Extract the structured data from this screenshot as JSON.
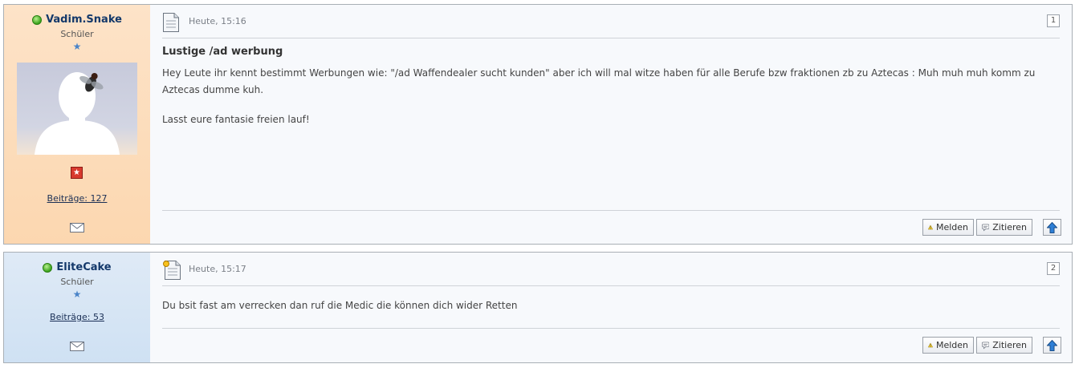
{
  "posts": [
    {
      "username": "Vadim.Snake",
      "rank": "Schüler",
      "rank_star": "★",
      "post_count": "Beiträge: 127",
      "date": "Heute, 15:16",
      "number": "1",
      "title": "Lustige /ad werbung",
      "paragraphs": [
        "Hey Leute ihr kennt bestimmt Werbungen wie: \"/ad Waffendealer sucht kunden\" aber ich will mal witze haben für alle Berufe bzw fraktionen zb zu Aztecas : Muh muh muh komm zu Aztecas dumme kuh.",
        "Lasst eure fantasie freien lauf!"
      ],
      "sidebar_color": "#fde3c8"
    },
    {
      "username": "EliteCake",
      "rank": "Schüler",
      "rank_star": "★",
      "post_count": "Beiträge: 53",
      "date": "Heute, 15:17",
      "number": "2",
      "paragraphs": [
        "Du bsit fast am verrecken dan ruf die Medic die können dich wider Retten"
      ],
      "sidebar_color": "#dfeaf6"
    }
  ],
  "actions": {
    "report_label": "Melden",
    "quote_label": "Zitieren",
    "report_icon": "warning-icon",
    "quote_icon": "quote-icon",
    "top_icon": "arrow-up-icon"
  }
}
